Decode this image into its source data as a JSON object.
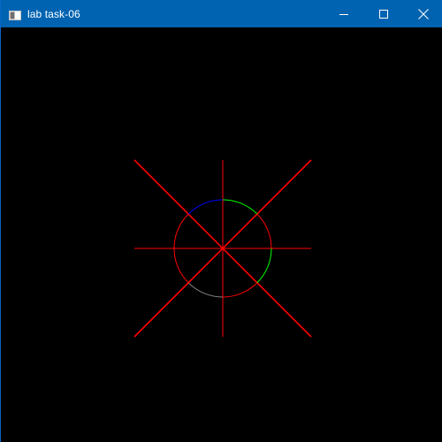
{
  "window": {
    "title": "lab task-06"
  },
  "icons": {
    "app": "app-window-icon",
    "minimize": "minimize-icon",
    "maximize": "maximize-icon",
    "close": "close-icon"
  },
  "colors": {
    "titlebar": "#0063b1",
    "canvas_background": "#000000",
    "axis_lines": "#ff0000",
    "circle_octants": [
      "#ff0000",
      "#00ff00",
      "#0000ff",
      "#ff0000",
      "#ff0000",
      "#808080",
      "#ff0000",
      "#00ff00"
    ]
  }
}
